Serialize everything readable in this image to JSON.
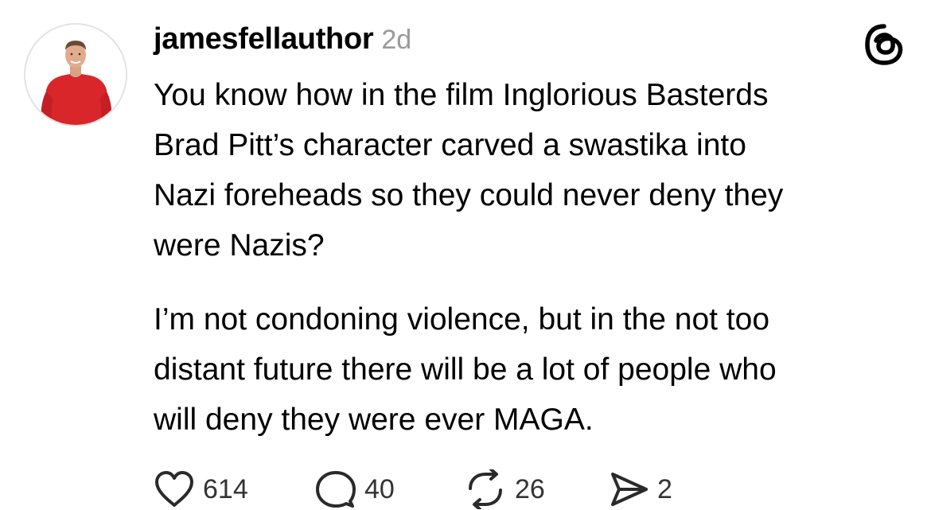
{
  "post": {
    "author": "jamesfellauthor",
    "time_ago": "2d",
    "app_icon": "threads-logo-icon",
    "paragraphs": [
      {
        "lines": [
          "You know how in the film Inglorious Basterds",
          "Brad Pitt’s character carved a swastika into",
          "Nazi foreheads so they could never deny they",
          "were Nazis?"
        ]
      },
      {
        "lines": [
          "I’m not condoning violence, but in the not too",
          "distant future there will be a lot of people who",
          "will deny they were ever MAGA."
        ]
      }
    ],
    "actions": {
      "likes": "614",
      "replies": "40",
      "reposts": "26",
      "shares": "2"
    }
  },
  "colors": {
    "text": "#000000",
    "muted": "#9a9a9a",
    "avatar_shirt": "#d8262b"
  }
}
